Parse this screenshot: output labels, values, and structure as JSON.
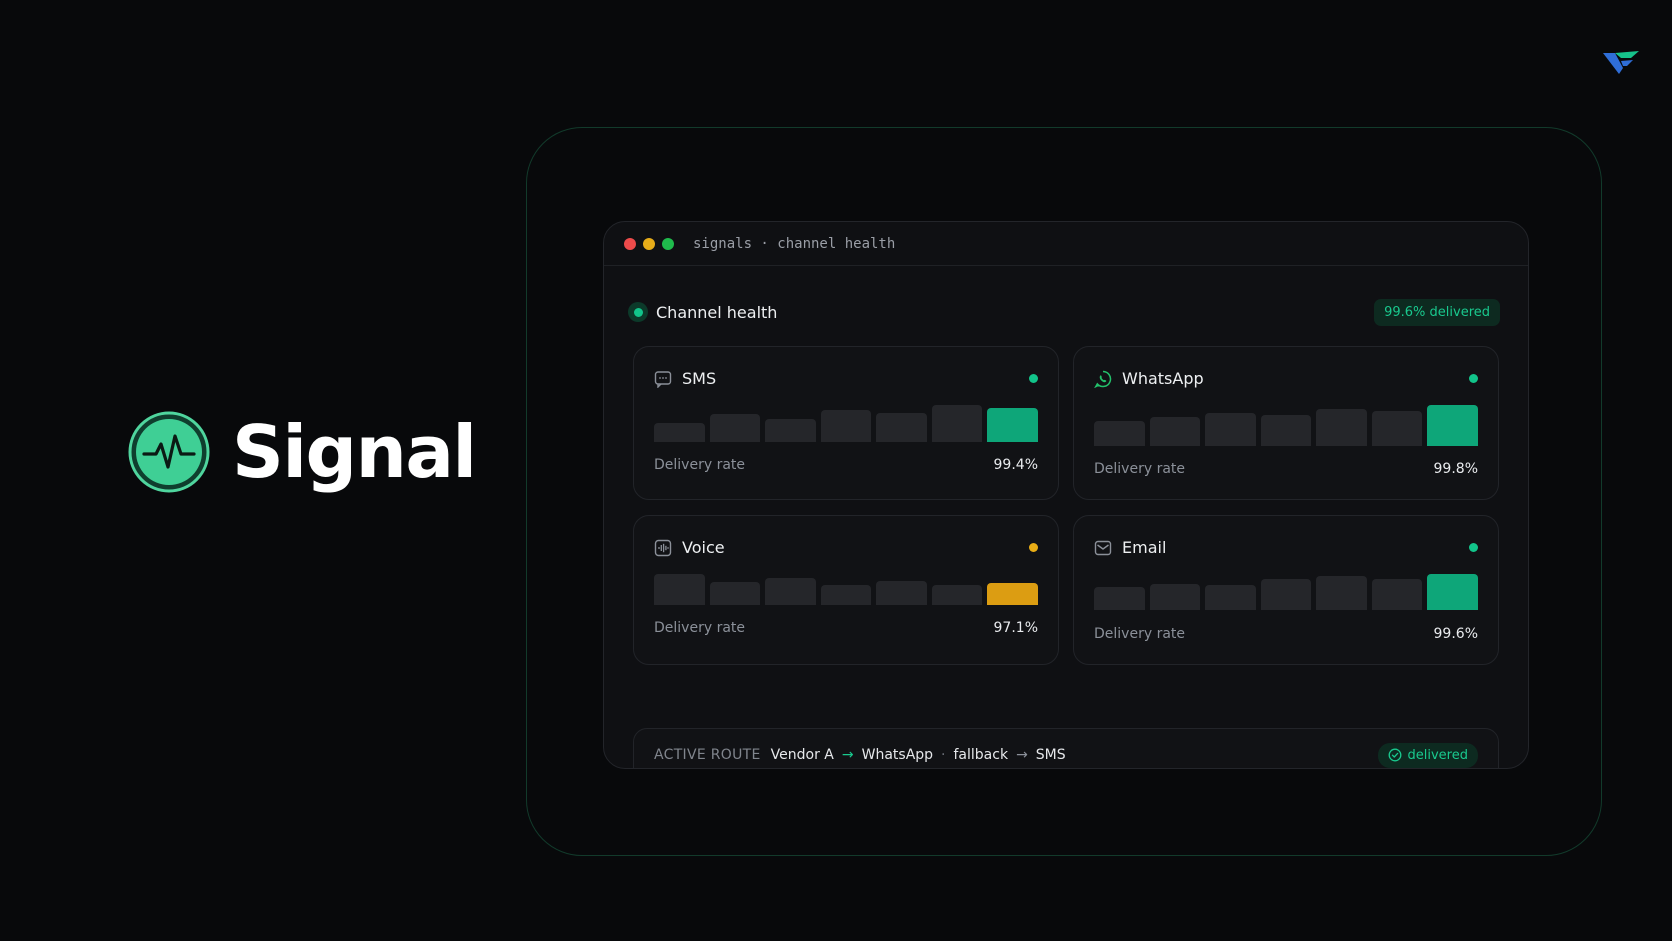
{
  "brand": {
    "name": "Signal",
    "logo_icon": "pulse-circle-icon"
  },
  "window": {
    "title": "signals · channel health",
    "traffic_lights": [
      "#ed4b4b",
      "#e6ac19",
      "#1fbb4c"
    ]
  },
  "health": {
    "title": "Channel health",
    "summary": "99.6% delivered"
  },
  "channels": [
    {
      "name": "SMS",
      "icon": "message-square-icon",
      "status": "ok",
      "metric_label": "Delivery rate",
      "metric_value": "99.4%"
    },
    {
      "name": "WhatsApp",
      "icon": "whatsapp-icon",
      "status": "ok",
      "metric_label": "Delivery rate",
      "metric_value": "99.8%"
    },
    {
      "name": "Voice",
      "icon": "waveform-icon",
      "status": "warn",
      "metric_label": "Delivery rate",
      "metric_value": "97.1%"
    },
    {
      "name": "Email",
      "icon": "mail-icon",
      "status": "ok",
      "metric_label": "Delivery rate",
      "metric_value": "99.6%"
    }
  ],
  "route": {
    "label": "ACTIVE ROUTE",
    "primary": "Vendor A",
    "channel": "WhatsApp",
    "fallback_label": "fallback",
    "fallback_channel": "SMS",
    "status": "delivered"
  },
  "colors": {
    "accent": "#12c48a",
    "warning": "#e9ad16",
    "background": "#08090b",
    "panel": "#0f1013"
  }
}
